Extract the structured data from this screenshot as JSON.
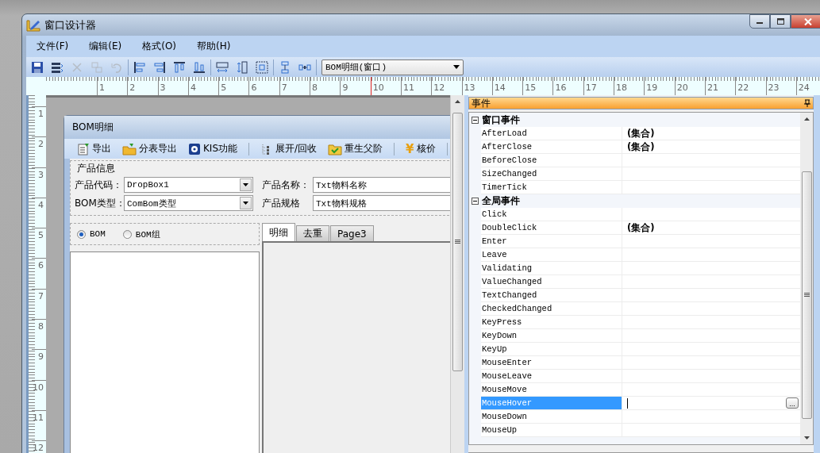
{
  "window": {
    "title": "窗口设计器"
  },
  "menu": [
    "文件(F)",
    "编辑(E)",
    "格式(O)",
    "帮助(H)"
  ],
  "toolbar": {
    "groups": [
      {
        "buttons": [
          {
            "kind": "save",
            "disabled": false
          },
          {
            "kind": "properties",
            "disabled": false
          },
          {
            "kind": "cut",
            "disabled": true
          },
          {
            "kind": "copy",
            "disabled": true
          },
          {
            "kind": "undo",
            "disabled": true
          }
        ]
      },
      {
        "buttons": [
          {
            "kind": "align-left",
            "disabled": false
          },
          {
            "kind": "align-right",
            "disabled": false
          },
          {
            "kind": "align-top",
            "disabled": false
          },
          {
            "kind": "align-bottom",
            "disabled": false
          }
        ]
      },
      {
        "buttons": [
          {
            "kind": "same-width",
            "disabled": false
          },
          {
            "kind": "same-height",
            "disabled": false
          },
          {
            "kind": "same-size",
            "disabled": false
          }
        ]
      },
      {
        "buttons": [
          {
            "kind": "vertical-spacing",
            "disabled": false
          },
          {
            "kind": "horizontal-spacing",
            "disabled": false
          }
        ]
      }
    ],
    "object_select": {
      "value": "BOM明细(窗口)"
    }
  },
  "ruler": {
    "horizontal": [
      "1",
      "2",
      "3",
      "4",
      "5",
      "6",
      "7",
      "8",
      "9",
      "10",
      "11",
      "12",
      "13",
      "14",
      "15",
      "16",
      "17",
      "18",
      "19",
      "20",
      "21",
      "22",
      "23",
      "24"
    ],
    "vertical": [
      "1",
      "2",
      "3",
      "4",
      "5",
      "6",
      "7",
      "8",
      "9",
      "10",
      "11",
      "12"
    ]
  },
  "form": {
    "title": "BOM明细",
    "toolbar": [
      {
        "kind": "export",
        "label": "导出"
      },
      {
        "kind": "split-export",
        "label": "分表导出"
      },
      {
        "kind": "kis",
        "label": "KIS功能"
      },
      {
        "kind": "separator"
      },
      {
        "kind": "tree",
        "label": "展开/回收"
      },
      {
        "kind": "folder",
        "label": "重生父阶"
      },
      {
        "kind": "separator"
      },
      {
        "kind": "glyph",
        "glyph": "¥",
        "label": "核价"
      },
      {
        "kind": "separator"
      }
    ],
    "group": {
      "title": "产品信息",
      "fields": [
        {
          "label": "产品代码：",
          "kind": "dropdown",
          "value": "DropBox1"
        },
        {
          "label": "产品名称：",
          "kind": "text",
          "value": "Txt物料名称"
        },
        {
          "label": "BOM类型：",
          "kind": "dropdown",
          "value": "ComBom类型"
        },
        {
          "label": "产品规格",
          "kind": "text",
          "value": "Txt物料规格"
        }
      ]
    },
    "radios": [
      {
        "label": "BOM",
        "selected": true
      },
      {
        "label": "BOM组",
        "selected": false
      }
    ],
    "tabs": [
      {
        "label": "明细",
        "selected": true
      },
      {
        "label": "去重",
        "selected": false
      },
      {
        "label": "Page3",
        "selected": false
      }
    ]
  },
  "events": {
    "title": "事件",
    "categories": [
      {
        "name": "窗口事件",
        "expanded": true,
        "rows": [
          {
            "name": "AfterLoad",
            "value": "(集合)",
            "selected": false
          },
          {
            "name": "AfterClose",
            "value": "(集合)",
            "selected": false
          },
          {
            "name": "BeforeClose",
            "selected": false
          },
          {
            "name": "SizeChanged",
            "selected": false
          },
          {
            "name": "TimerTick",
            "selected": false
          }
        ]
      },
      {
        "name": "全局事件",
        "expanded": true,
        "rows": [
          {
            "name": "Click",
            "selected": false
          },
          {
            "name": "DoubleClick",
            "value": "(集合)",
            "selected": false
          },
          {
            "name": "Enter",
            "selected": false
          },
          {
            "name": "Leave",
            "selected": false
          },
          {
            "name": "Validating",
            "selected": false
          },
          {
            "name": "ValueChanged",
            "selected": false
          },
          {
            "name": "TextChanged",
            "selected": false
          },
          {
            "name": "CheckedChanged",
            "selected": false
          },
          {
            "name": "KeyPress",
            "selected": false
          },
          {
            "name": "KeyDown",
            "selected": false
          },
          {
            "name": "KeyUp",
            "selected": false
          },
          {
            "name": "MouseEnter",
            "selected": false
          },
          {
            "name": "MouseLeave",
            "selected": false
          },
          {
            "name": "MouseMove",
            "selected": false
          },
          {
            "name": "MouseHover",
            "selected": true,
            "button": "..."
          },
          {
            "name": "MouseDown",
            "selected": false
          },
          {
            "name": "MouseUp",
            "selected": false
          }
        ]
      }
    ]
  }
}
